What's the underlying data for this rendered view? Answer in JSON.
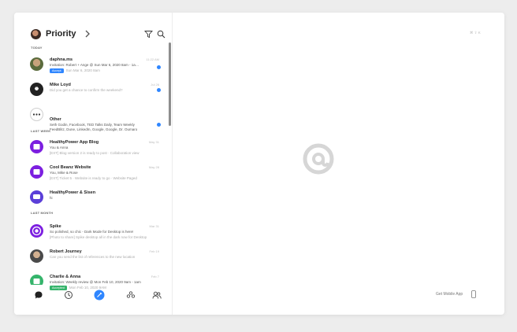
{
  "sidebar": {
    "title": "Priority",
    "sections": [
      {
        "label": "TODAY"
      },
      {
        "label": "LAST WEEK"
      },
      {
        "label": "LAST MONTH"
      }
    ],
    "items": [
      {
        "name": "daphna.ms",
        "line1": "Invitation: Robert + Ange @ Sun Mar 6, 2020 8am - 1a…",
        "badge": "Accept",
        "line2": "Sun Mar 6, 2020 8am",
        "time": "11:22 AM",
        "unread": true
      },
      {
        "name": "Mike Loyd",
        "line1": "Did you get a chance to confirm the weekend?",
        "line2": "",
        "time": "Jul 26",
        "unread": true
      },
      {
        "name": "Other",
        "line1": "Seth Godin, Facebook, TED Talks Daily, Team Weekly",
        "line2": "FeedBlitz, Dune, LinkedIn, Google, Google, Dr. Oumaro",
        "time": "",
        "unread": true
      },
      {
        "name": "HealthyPower App Blog",
        "line1": "You & Anna",
        "line2": "[EXT] Blog version 2 is ready to post · Collaboration view",
        "time": "May 31"
      },
      {
        "name": "Cool Beanz Website",
        "line1": "You, Mike & Rose",
        "line2": "[EXT] Ticket 5 · Website is ready to go · Website Paged",
        "time": "May 28"
      },
      {
        "name": "HealthyPower & Sisen",
        "line1": "hi",
        "line2": "",
        "time": ""
      },
      {
        "name": "Spike",
        "line1": "So polished, so chic - Dark Mode for Desktop is here!",
        "line2": "[Photo to share] Spike desktop all in the dark now for Desktop",
        "time": "Mar 31"
      },
      {
        "name": "Robert Journey",
        "line1": "Can you send the list of references to the new location",
        "line2": "",
        "time": "Feb 19"
      },
      {
        "name": "Charlie & Anna",
        "line1": "Invitation: Weekly review @ Mon Feb 10, 2020 9am - 1am",
        "badge": "Accepted",
        "line2": "Mon Feb 10, 2020 9AM",
        "time": "Feb 7"
      }
    ]
  },
  "main": {
    "top_label": "⌘ ⇧ K",
    "get_mobile": "Get Mobile App"
  },
  "colors": {
    "accent": "#2f86ff",
    "purple": "#7c1fe0",
    "green": "#35b46b"
  }
}
